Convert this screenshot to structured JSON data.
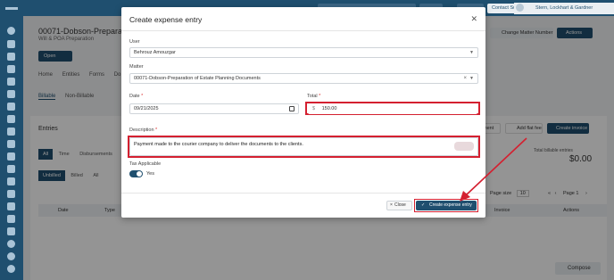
{
  "topbar": {
    "contact_support": "Contact Support",
    "firm_name": "Stern, Lockhart & Gardner"
  },
  "background": {
    "matter_title": "00071-Dobson-Preparation",
    "matter_subtitle": "Will & POA Preparation",
    "open_button": "Open",
    "tabs": [
      "Home",
      "Entities",
      "Forms",
      "Do"
    ],
    "change_matter_number": "Change Matter Number",
    "actions": "Actions",
    "billing_tabs": [
      "Billable",
      "Non-Billable"
    ],
    "entries_heading": "Entries",
    "filter_tabs": [
      "All",
      "Time",
      "Disbursements"
    ],
    "billed_tabs": [
      "Unbilled",
      "Billed",
      "All"
    ],
    "payment_button": "ment",
    "add_flat_fee": "Add flat fee",
    "create_invoice": "Create invoice",
    "total_label": "Total billable entries",
    "total_value": "$0.00",
    "page_size_label": "Page size",
    "page_size_value": "10",
    "pager_label": "Page 1",
    "table_headers": [
      "Date",
      "Type",
      "Invoice",
      "Actions"
    ],
    "compose": "Compose"
  },
  "modal": {
    "title": "Create expense entry",
    "user_label": "User",
    "user_value": "Behrouz Amouzgar",
    "matter_label": "Matter",
    "matter_value": "00071-Dobson-Preparation of Estate Planning Documents",
    "date_label": "Date",
    "date_value": "09/21/2025",
    "total_label": "Total",
    "total_currency": "$",
    "total_value": "150.00",
    "description_label": "Description",
    "description_value": "Payment made to the courier company to deliver the documents to the clients.",
    "tax_label": "Tax Applicable",
    "tax_value": "Yes",
    "close_button": "Close",
    "create_button": "Create expense entry",
    "required_mark": "*"
  },
  "colors": {
    "primary": "#1f4f6f",
    "highlight": "#d42030"
  }
}
